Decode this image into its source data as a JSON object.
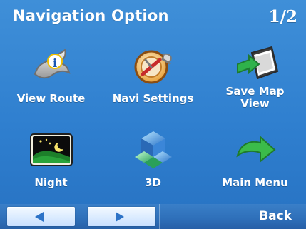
{
  "header": {
    "title": "Navigation Option",
    "page_indicator": "1/2"
  },
  "menu": {
    "items": [
      {
        "label": "View Route",
        "icon": "view-route-icon"
      },
      {
        "label": "Navi Settings",
        "icon": "navi-settings-icon"
      },
      {
        "label": "Save Map\nView",
        "icon": "save-map-view-icon"
      },
      {
        "label": "Night",
        "icon": "night-icon"
      },
      {
        "label": "3D",
        "icon": "3d-icon"
      },
      {
        "label": "Main Menu",
        "icon": "main-menu-icon"
      }
    ]
  },
  "footer": {
    "back_label": "Back",
    "prev_icon": "triangle-left-icon",
    "next_icon": "triangle-right-icon"
  },
  "colors": {
    "background": "#3f8fd8",
    "text": "#ffffff",
    "footer": "#2e6fb9",
    "nav_button": "#dfeeff",
    "triangle": "#2d73c7"
  }
}
